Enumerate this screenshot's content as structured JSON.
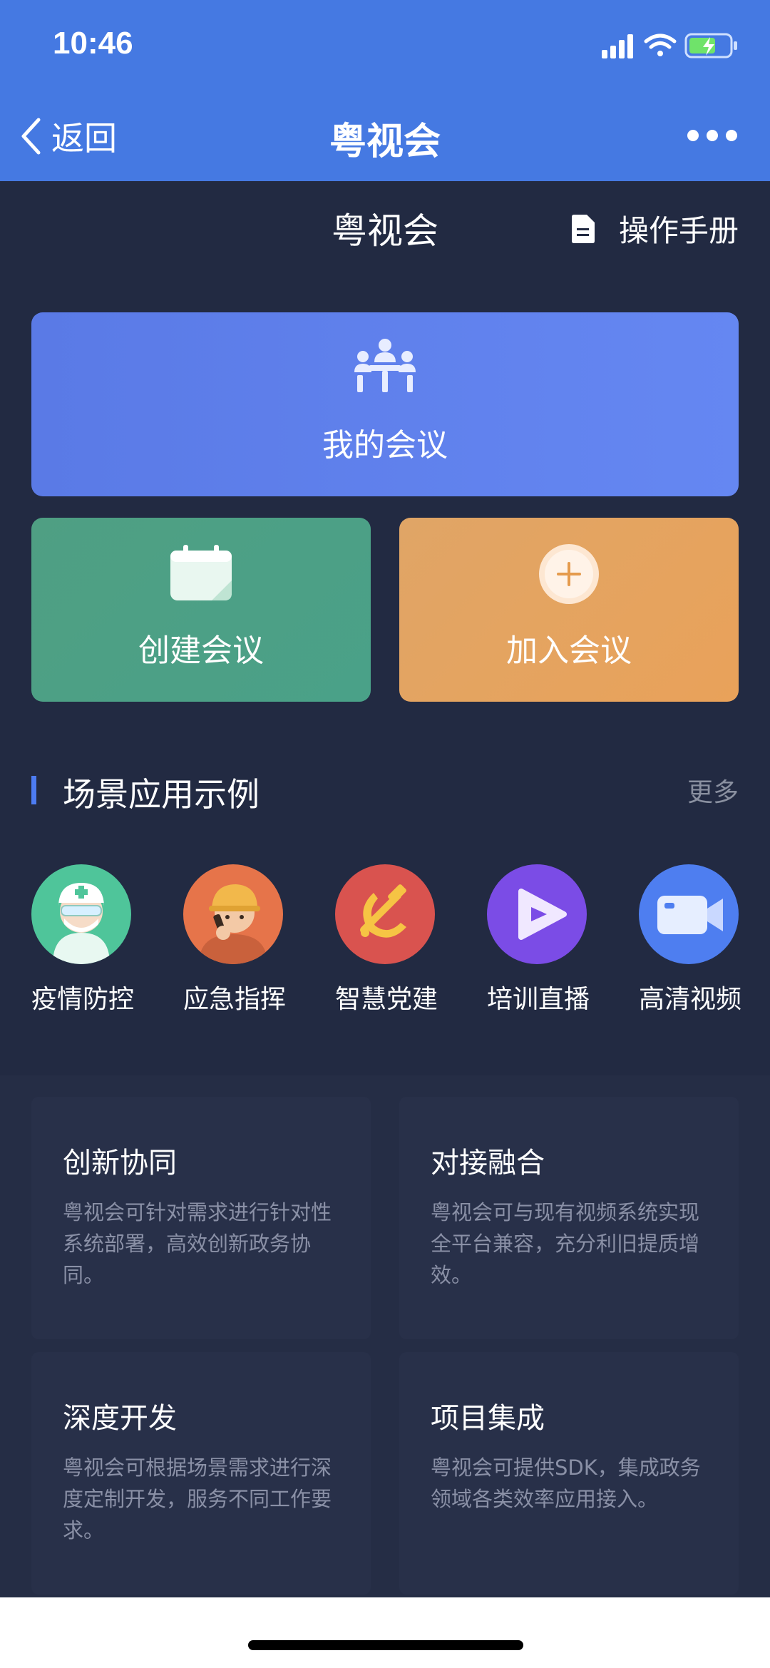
{
  "status_bar": {
    "time": "10:46"
  },
  "nav": {
    "back_label": "返回",
    "title": "粤视会"
  },
  "header": {
    "title": "粤视会",
    "manual_label": "操作手册"
  },
  "cards": {
    "my_meetings": "我的会议",
    "create_meeting": "创建会议",
    "join_meeting": "加入会议"
  },
  "section": {
    "title": "场景应用示例",
    "more_label": "更多"
  },
  "scenes": [
    {
      "label": "疫情防控",
      "icon": "doctor-icon"
    },
    {
      "label": "应急指挥",
      "icon": "walkie-talkie-worker-icon"
    },
    {
      "label": "智慧党建",
      "icon": "party-emblem-icon"
    },
    {
      "label": "培训直播",
      "icon": "play-icon"
    },
    {
      "label": "高清视频",
      "icon": "video-camera-icon"
    }
  ],
  "features": [
    {
      "title": "创新协同",
      "desc": "粤视会可针对需求进行针对性系统部署，高效创新政务协同。"
    },
    {
      "title": "对接融合",
      "desc": "粤视会可与现有视频系统实现全平台兼容，充分利旧提质增效。"
    },
    {
      "title": "深度开发",
      "desc": "粤视会可根据场景需求进行深度定制开发，服务不同工作要求。"
    },
    {
      "title": "项目集成",
      "desc": "粤视会可提供SDK，集成政务领域各类效率应用接入。"
    }
  ],
  "colors": {
    "nav_blue": "#4579e2",
    "my_card": "#5f82ee",
    "create_card": "#4da085",
    "join_card": "#e6a45f",
    "background": "#222a42"
  }
}
